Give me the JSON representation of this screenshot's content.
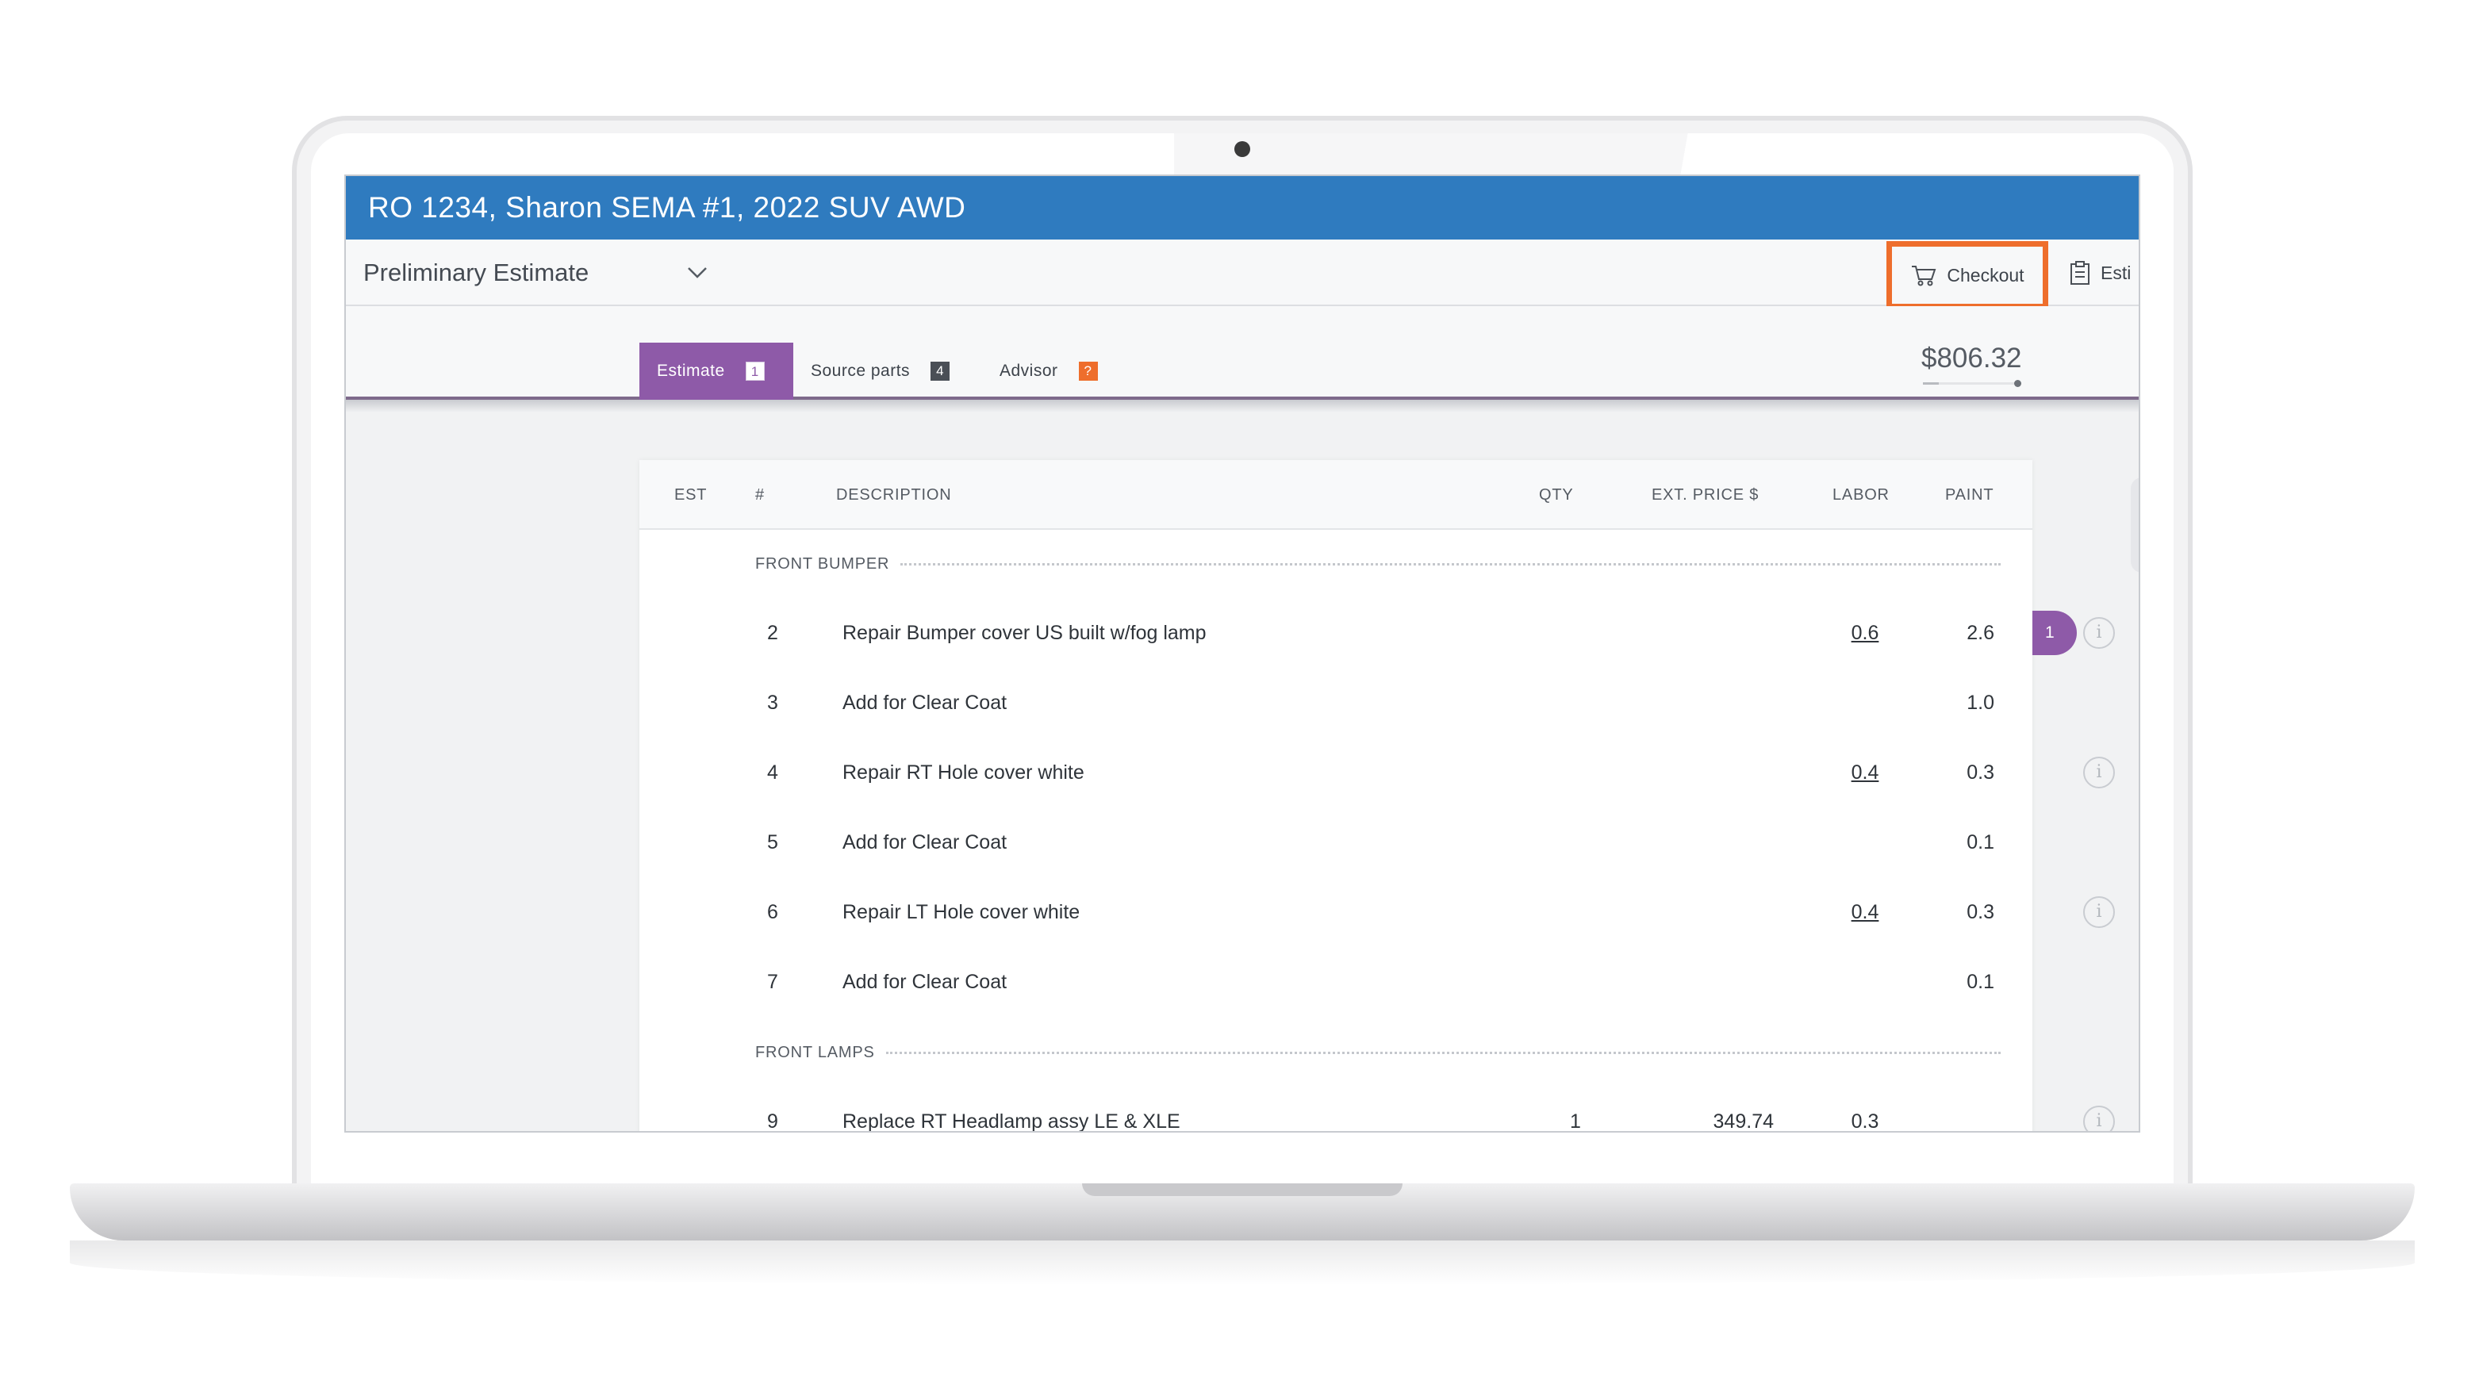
{
  "window": {
    "title": "RO 1234, Sharon SEMA #1, 2022 SUV AWD"
  },
  "toolbar": {
    "estimate_select": "Preliminary Estimate",
    "checkout_label": "Checkout",
    "estimate_button_label": "Esti"
  },
  "tabs": [
    {
      "label": "Estimate",
      "badge": "1",
      "active": true
    },
    {
      "label": "Source parts",
      "badge": "4",
      "active": false
    },
    {
      "label": "Advisor",
      "badge": "?",
      "active": false
    }
  ],
  "total": "$806.32",
  "table": {
    "headers": {
      "est": "EST",
      "num": "#",
      "description": "DESCRIPTION",
      "qty": "QTY",
      "ext_price": "EXT. PRICE $",
      "labor": "LABOR",
      "paint": "PAINT"
    },
    "groups": [
      {
        "name": "FRONT BUMPER",
        "rows": [
          {
            "num": "2",
            "description": "Repair Bumper cover US built w/fog lamp",
            "qty": "",
            "ext_price": "",
            "labor": "0.6",
            "paint": "2.6",
            "flag": "1"
          },
          {
            "num": "3",
            "description": "Add for Clear Coat",
            "qty": "",
            "ext_price": "",
            "labor": "",
            "paint": "1.0"
          },
          {
            "num": "4",
            "description": "Repair RT Hole cover white",
            "qty": "",
            "ext_price": "",
            "labor": "0.4",
            "paint": "0.3"
          },
          {
            "num": "5",
            "description": "Add for Clear Coat",
            "qty": "",
            "ext_price": "",
            "labor": "",
            "paint": "0.1"
          },
          {
            "num": "6",
            "description": "Repair LT Hole cover white",
            "qty": "",
            "ext_price": "",
            "labor": "0.4",
            "paint": "0.3"
          },
          {
            "num": "7",
            "description": "Add for Clear Coat",
            "qty": "",
            "ext_price": "",
            "labor": "",
            "paint": "0.1"
          }
        ]
      },
      {
        "name": "FRONT LAMPS",
        "rows": [
          {
            "num": "9",
            "description": "Replace RT Headlamp assy LE & XLE",
            "qty": "1",
            "ext_price": "349.74",
            "labor": "0.3",
            "paint": ""
          }
        ]
      }
    ]
  },
  "colors": {
    "titlebar": "#2f7bbf",
    "active_tab": "#8e5aa8",
    "checkout_highlight": "#ee6e2c",
    "advisor_badge": "#ee6e2c"
  },
  "icons": [
    "chevron-down-icon",
    "cart-icon",
    "clipboard-icon",
    "info-icon"
  ]
}
